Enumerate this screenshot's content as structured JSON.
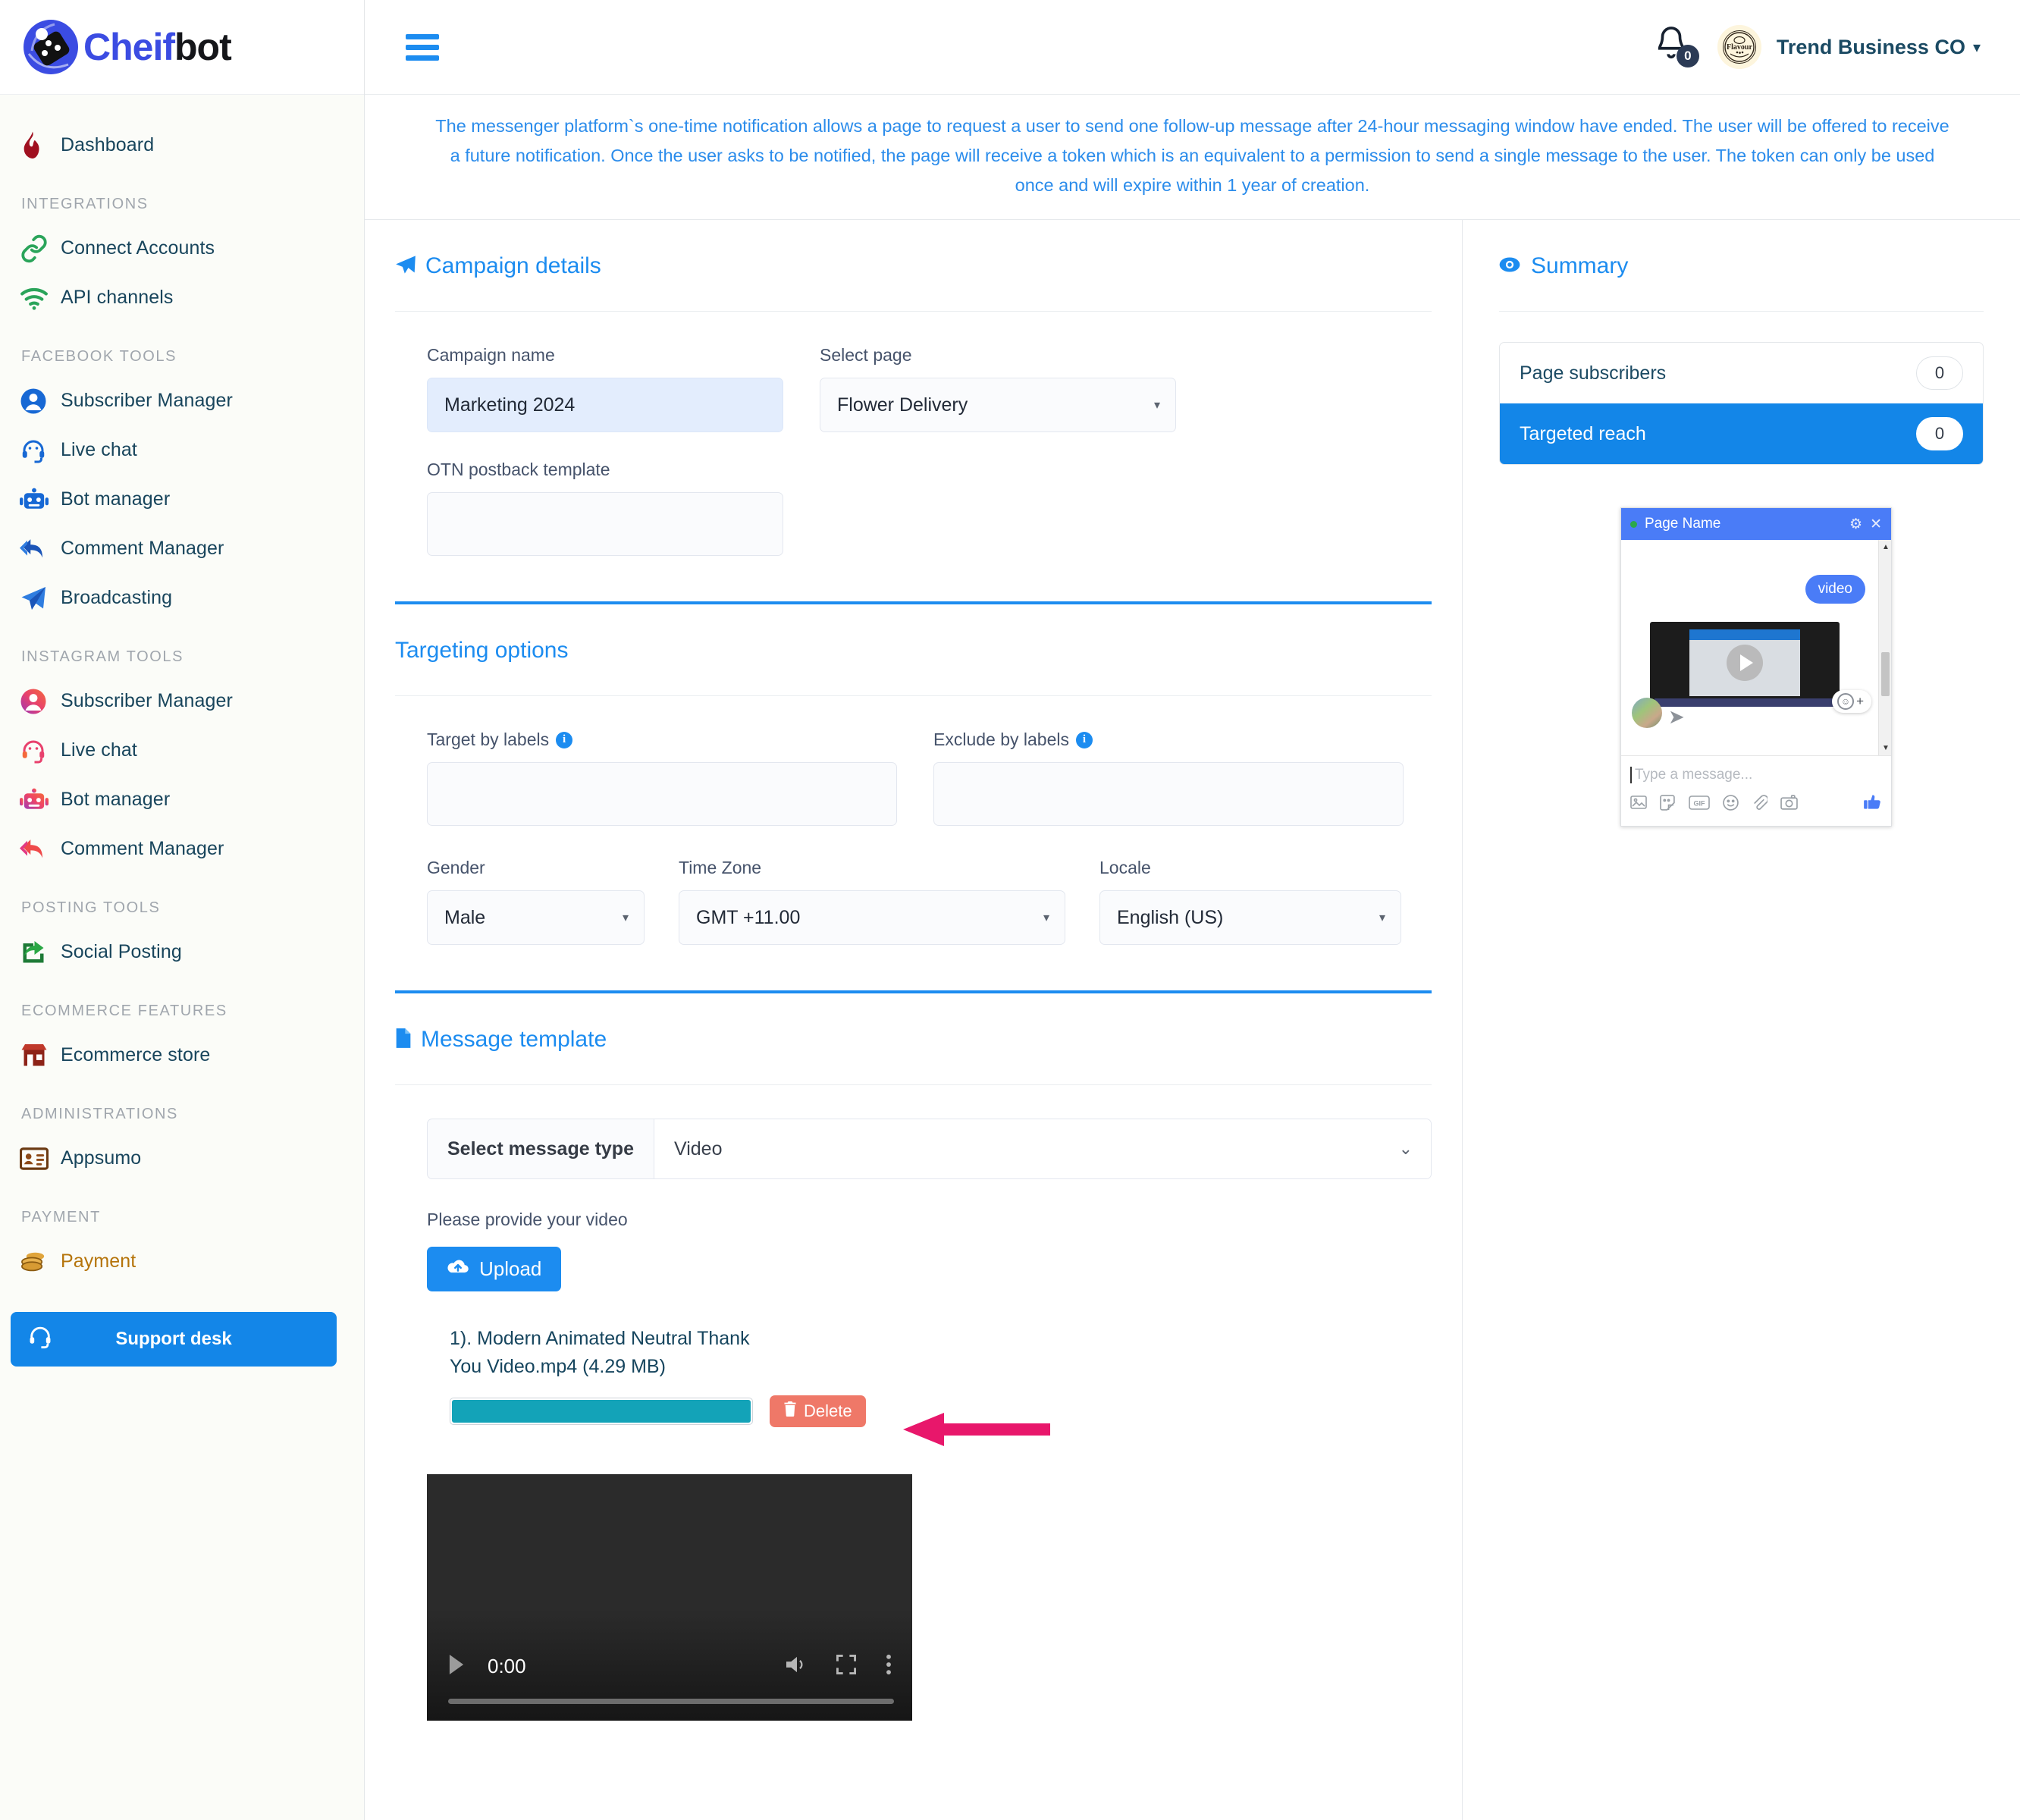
{
  "brand": {
    "name_part1": "Cheif",
    "name_part2": "bot"
  },
  "topbar": {
    "notification_count": "0",
    "account_name": "Trend Business CO",
    "avatar_text": "Flavour",
    "caret": "▾"
  },
  "notice": {
    "text": "The messenger platform`s one-time notification allows a page to request a user to send one follow-up message after 24-hour messaging window have ended. The user will be offered to receive a future notification. Once the user asks to be notified, the page will receive a token which is an equivalent to a permission to send a single message to the user. The token can only be used once and will expire within 1 year of creation."
  },
  "sidebar": {
    "items": [
      {
        "label": "Dashboard",
        "icon": "flame-icon",
        "section": null
      },
      {
        "label": "Connect Accounts",
        "icon": "link-icon",
        "section": "INTEGRATIONS"
      },
      {
        "label": "API channels",
        "icon": "wifi-icon",
        "section": null
      },
      {
        "label": "Subscriber Manager",
        "icon": "user-circle-icon",
        "section": "FACEBOOK TOOLS"
      },
      {
        "label": "Live chat",
        "icon": "headset-icon",
        "section": null
      },
      {
        "label": "Bot manager",
        "icon": "robot-icon",
        "section": null
      },
      {
        "label": "Comment Manager",
        "icon": "reply-all-icon",
        "section": null
      },
      {
        "label": "Broadcasting",
        "icon": "paper-plane-icon",
        "section": null
      },
      {
        "label": "Subscriber Manager",
        "icon": "user-circle-icon",
        "section": "INSTAGRAM TOOLS"
      },
      {
        "label": "Live chat",
        "icon": "headset-icon",
        "section": null
      },
      {
        "label": "Bot manager",
        "icon": "robot-icon",
        "section": null
      },
      {
        "label": "Comment Manager",
        "icon": "reply-all-icon",
        "section": null
      },
      {
        "label": "Social Posting",
        "icon": "share-square-icon",
        "section": "POSTING TOOLS"
      },
      {
        "label": "Ecommerce store",
        "icon": "store-icon",
        "section": "ECOMMERCE FEATURES"
      },
      {
        "label": "Appsumo",
        "icon": "id-card-icon",
        "section": "ADMINISTRATIONS"
      },
      {
        "label": "Payment",
        "icon": "coins-icon",
        "section": "PAYMENT"
      }
    ],
    "sections": {
      "integrations": "INTEGRATIONS",
      "facebook_tools": "FACEBOOK TOOLS",
      "instagram_tools": "INSTAGRAM TOOLS",
      "posting_tools": "POSTING TOOLS",
      "ecommerce_features": "ECOMMERCE FEATURES",
      "administrations": "ADMINISTRATIONS",
      "payment": "PAYMENT"
    },
    "support_button": "Support desk"
  },
  "campaign_details": {
    "title": "Campaign details",
    "campaign_name_label": "Campaign name",
    "campaign_name_value": "Marketing 2024",
    "select_page_label": "Select page",
    "select_page_value": "Flower Delivery",
    "otn_label": "OTN postback template",
    "otn_value": ""
  },
  "targeting_options": {
    "title": "Targeting options",
    "target_labels_label": "Target by labels",
    "target_labels_value": "",
    "exclude_labels_label": "Exclude by labels",
    "exclude_labels_value": "",
    "gender_label": "Gender",
    "gender_value": "Male",
    "timezone_label": "Time Zone",
    "timezone_value": "GMT +11.00",
    "locale_label": "Locale",
    "locale_value": "English (US)"
  },
  "message_template": {
    "title": "Message template",
    "select_label": "Select message type",
    "select_value": "Video",
    "hint": "Please provide your video",
    "upload_label": "Upload",
    "file_name": "1). Modern Animated Neutral Thank You Video.mp4 (4.29 MB)",
    "delete_label": "Delete",
    "progress_percent": "100"
  },
  "video_player": {
    "current_time": "0:00"
  },
  "summary": {
    "title": "Summary",
    "rows": [
      {
        "label": "Page subscribers",
        "value": "0"
      },
      {
        "label": "Targeted reach",
        "value": "0"
      }
    ]
  },
  "messenger_preview": {
    "page_name": "Page Name",
    "bubble_text": "video",
    "input_placeholder": "Type a message...",
    "gif_label": "GIF"
  },
  "colors": {
    "accent_blue": "#1c8cf0",
    "brand_blue": "#3b4ce2",
    "active_row": "#1386e8",
    "delete_red": "#ef7868",
    "progress_teal": "#13a3b8",
    "arrow_pink": "#e8176b",
    "sidebar_text": "#18455c",
    "payment_amber": "#b5740a"
  }
}
